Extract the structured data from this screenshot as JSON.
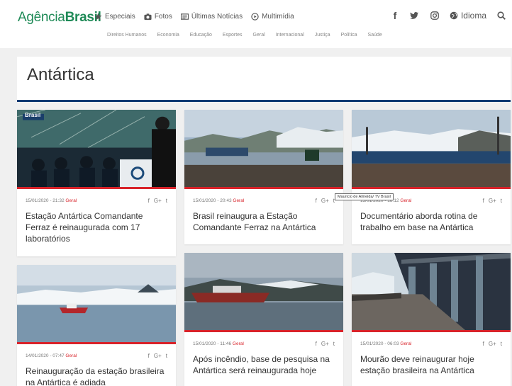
{
  "header": {
    "logo_part1": "Agência",
    "logo_part2": "Brasil",
    "topnav": [
      {
        "label": "Especiais",
        "icon": "star-icon"
      },
      {
        "label": "Fotos",
        "icon": "camera-icon"
      },
      {
        "label": "Últimas Notícias",
        "icon": "newspaper-icon"
      },
      {
        "label": "Multimídia",
        "icon": "multimedia-icon"
      }
    ],
    "idioma": "Idioma",
    "subnav": [
      "Direitos Humanos",
      "Economia",
      "Educação",
      "Esportes",
      "Geral",
      "Internacional",
      "Justiça",
      "Política",
      "Saúde"
    ]
  },
  "page": {
    "title": "Antártica"
  },
  "tooltip": "Mauricio de Almeida/ TV Brasil",
  "image_overlay": "Brasil",
  "cards": [
    {
      "date": "15/01/2020 - 21:32",
      "category": "Geral",
      "headline": "Estação Antártica Comandante Ferraz é reinaugurada com 17 laboratórios"
    },
    {
      "date": "15/01/2020 - 20:43",
      "category": "Geral",
      "headline": "Brasil reinaugura a Estação Comandante Ferraz na Antártica"
    },
    {
      "date": "15/01/2020 - 18:12",
      "category": "Geral",
      "headline": "Documentário aborda rotina de trabalho em base na Antártica"
    },
    {
      "date": "14/01/2020 - 07:47",
      "category": "Geral",
      "headline": "Reinauguração da estação brasileira na Antártica é adiada"
    },
    {
      "date": "15/01/2020 - 11:46",
      "category": "Geral",
      "headline": "Após incêndio, base de pesquisa na Antártica será reinaugurada hoje"
    },
    {
      "date": "15/01/2020 - 06:03",
      "category": "Geral",
      "headline": "Mourão deve reinaugurar hoje estação brasileira na Antártica"
    }
  ],
  "share": {
    "facebook": "f",
    "gplus": "G+",
    "twitter": "t"
  },
  "colors": {
    "brand_green": "#1f8a57",
    "accent_red": "#d8232a",
    "title_rule": "#0d3a73"
  }
}
